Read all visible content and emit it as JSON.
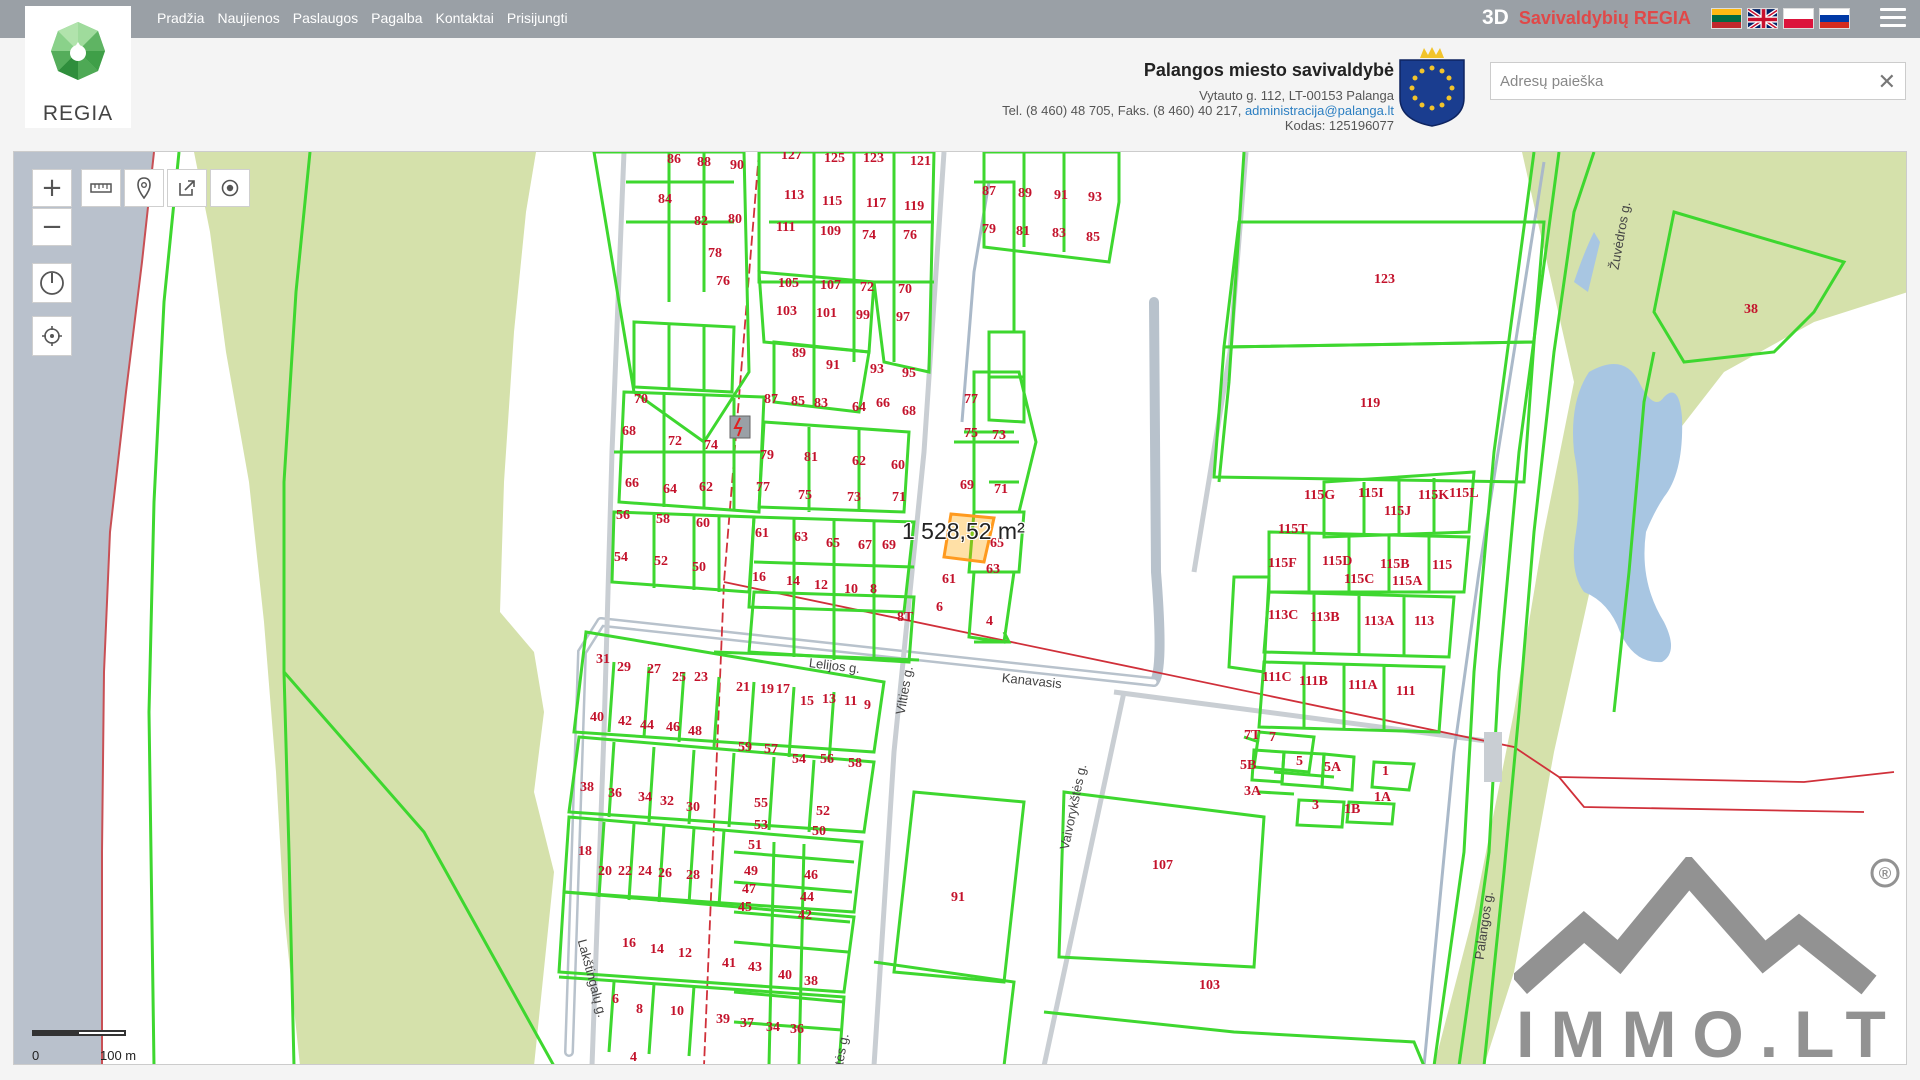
{
  "nav": {
    "items": [
      "Pradžia",
      "Naujienos",
      "Paslaugos",
      "Pagalba",
      "Kontaktai",
      "Prisijungti"
    ]
  },
  "logo": {
    "text": "REGIA"
  },
  "brand": {
    "prefix": "3D",
    "name": "Savivaldybių REGIA"
  },
  "languages": [
    "lithuania-flag",
    "uk-flag",
    "poland-flag",
    "russia-flag"
  ],
  "municipality": {
    "name": "Palangos miesto savivaldybė",
    "address": "Vytauto g. 112, LT-00153 Palanga",
    "phone_prefix": "Tel. (8 460) 48 705, Faks. (8 460) 40 217, ",
    "email": "administracija@palanga.lt",
    "code": "Kodas: 125196077"
  },
  "search": {
    "placeholder": "Adresų paieška",
    "value": ""
  },
  "map": {
    "measurement": "1 528,52 m²",
    "scale": {
      "zero": "0",
      "distance": "100 m"
    },
    "streets": {
      "lelijos": "Lelijos g.",
      "kanavasis": "Kanavasis",
      "vaivorykstes": "Vaivorykštės g.",
      "vilties": "Vilties g.",
      "vaivorykstes2": "Vaivorykštės g.",
      "lakstingalu": "Lakštingalų g.",
      "rudmiskiu": "Žuvėdros g.",
      "parkas": "Palangos g."
    },
    "plots": [
      {
        "id": "p1",
        "label": "86"
      },
      {
        "id": "p2",
        "label": "88"
      },
      {
        "id": "p3",
        "label": "90"
      },
      {
        "id": "p4",
        "label": "84"
      },
      {
        "id": "p5",
        "label": "82"
      },
      {
        "id": "p6",
        "label": "80"
      },
      {
        "id": "p7",
        "label": "78"
      },
      {
        "id": "p8",
        "label": "76"
      },
      {
        "id": "p9",
        "label": "127"
      },
      {
        "id": "p10",
        "label": "125"
      },
      {
        "id": "p11",
        "label": "123"
      },
      {
        "id": "p12",
        "label": "121"
      },
      {
        "id": "p13",
        "label": "113"
      },
      {
        "id": "p14",
        "label": "115"
      },
      {
        "id": "p15",
        "label": "117"
      },
      {
        "id": "p16",
        "label": "119"
      },
      {
        "id": "p17",
        "label": "111"
      },
      {
        "id": "p18",
        "label": "109"
      },
      {
        "id": "p19",
        "label": "74"
      },
      {
        "id": "p20",
        "label": "76"
      },
      {
        "id": "p21",
        "label": "105"
      },
      {
        "id": "p22",
        "label": "107"
      },
      {
        "id": "p23",
        "label": "72"
      },
      {
        "id": "p24",
        "label": "70"
      },
      {
        "id": "p25",
        "label": "103"
      },
      {
        "id": "p26",
        "label": "101"
      },
      {
        "id": "p27",
        "label": "99"
      },
      {
        "id": "p28",
        "label": "97"
      },
      {
        "id": "p29",
        "label": "89"
      },
      {
        "id": "p30",
        "label": "91"
      },
      {
        "id": "p31",
        "label": "93"
      },
      {
        "id": "p32",
        "label": "95"
      },
      {
        "id": "p33",
        "label": "87"
      },
      {
        "id": "p34",
        "label": "85"
      },
      {
        "id": "p35",
        "label": "83"
      },
      {
        "id": "p36",
        "label": "64"
      },
      {
        "id": "p37",
        "label": "66"
      },
      {
        "id": "p38",
        "label": "68"
      },
      {
        "id": "p39",
        "label": "87"
      },
      {
        "id": "p40",
        "label": "89"
      },
      {
        "id": "p41",
        "label": "91"
      },
      {
        "id": "p42",
        "label": "93"
      },
      {
        "id": "p43",
        "label": "79"
      },
      {
        "id": "p44",
        "label": "81"
      },
      {
        "id": "p45",
        "label": "83"
      },
      {
        "id": "p46",
        "label": "85"
      },
      {
        "id": "p47",
        "label": "70"
      },
      {
        "id": "p48",
        "label": "68"
      },
      {
        "id": "p49",
        "label": "72"
      },
      {
        "id": "p50",
        "label": "74"
      },
      {
        "id": "p51",
        "label": "66"
      },
      {
        "id": "p52",
        "label": "64"
      },
      {
        "id": "p53",
        "label": "62"
      },
      {
        "id": "p54",
        "label": "56"
      },
      {
        "id": "p55",
        "label": "58"
      },
      {
        "id": "p56",
        "label": "60"
      },
      {
        "id": "p57",
        "label": "54"
      },
      {
        "id": "p58",
        "label": "52"
      },
      {
        "id": "p59",
        "label": "50"
      },
      {
        "id": "p60",
        "label": "79"
      },
      {
        "id": "p61",
        "label": "81"
      },
      {
        "id": "p62",
        "label": "62"
      },
      {
        "id": "p63",
        "label": "60"
      },
      {
        "id": "p64",
        "label": "77"
      },
      {
        "id": "p65",
        "label": "75"
      },
      {
        "id": "p66",
        "label": "73"
      },
      {
        "id": "p67",
        "label": "71"
      },
      {
        "id": "p68",
        "label": "61"
      },
      {
        "id": "p69",
        "label": "63"
      },
      {
        "id": "p70",
        "label": "65"
      },
      {
        "id": "p71",
        "label": "67"
      },
      {
        "id": "p72",
        "label": "69"
      },
      {
        "id": "p73",
        "label": "16"
      },
      {
        "id": "p74",
        "label": "14"
      },
      {
        "id": "p75",
        "label": "12"
      },
      {
        "id": "p76",
        "label": "10"
      },
      {
        "id": "p77",
        "label": "8"
      },
      {
        "id": "p78",
        "label": "77"
      },
      {
        "id": "p79",
        "label": "75"
      },
      {
        "id": "p80",
        "label": "73"
      },
      {
        "id": "p81",
        "label": "69"
      },
      {
        "id": "p82",
        "label": "71"
      },
      {
        "id": "p83",
        "label": "63"
      },
      {
        "id": "p84",
        "label": "65"
      },
      {
        "id": "p85",
        "label": "61"
      },
      {
        "id": "p86",
        "label": "6"
      },
      {
        "id": "p87",
        "label": "4"
      },
      {
        "id": "p88",
        "label": "8T"
      },
      {
        "id": "p89",
        "label": "123"
      },
      {
        "id": "p90",
        "label": "119"
      },
      {
        "id": "p91",
        "label": "38"
      },
      {
        "id": "p92",
        "label": "115G"
      },
      {
        "id": "p93",
        "label": "115I"
      },
      {
        "id": "p94",
        "label": "115K"
      },
      {
        "id": "p95",
        "label": "115L"
      },
      {
        "id": "p96",
        "label": "115J"
      },
      {
        "id": "p97",
        "label": "115T"
      },
      {
        "id": "p98",
        "label": "115F"
      },
      {
        "id": "p99",
        "label": "115D"
      },
      {
        "id": "p100",
        "label": "115C"
      },
      {
        "id": "p101",
        "label": "115B"
      },
      {
        "id": "p102",
        "label": "115A"
      },
      {
        "id": "p103",
        "label": "115"
      },
      {
        "id": "p104",
        "label": "113C"
      },
      {
        "id": "p105",
        "label": "113B"
      },
      {
        "id": "p106",
        "label": "113A"
      },
      {
        "id": "p107",
        "label": "113"
      },
      {
        "id": "p108",
        "label": "111C"
      },
      {
        "id": "p109",
        "label": "111B"
      },
      {
        "id": "p110",
        "label": "111A"
      },
      {
        "id": "p111",
        "label": "111"
      },
      {
        "id": "p112",
        "label": "7T"
      },
      {
        "id": "p113",
        "label": "7"
      },
      {
        "id": "p114",
        "label": "5B"
      },
      {
        "id": "p115",
        "label": "5"
      },
      {
        "id": "p116",
        "label": "5A"
      },
      {
        "id": "p117",
        "label": "1"
      },
      {
        "id": "p118",
        "label": "3A"
      },
      {
        "id": "p119",
        "label": "3"
      },
      {
        "id": "p120",
        "label": "1B"
      },
      {
        "id": "p121",
        "label": "1A"
      },
      {
        "id": "p122",
        "label": "107"
      },
      {
        "id": "p123",
        "label": "103"
      },
      {
        "id": "p124",
        "label": "91"
      },
      {
        "id": "p125",
        "label": "31"
      },
      {
        "id": "p126",
        "label": "29"
      },
      {
        "id": "p127",
        "label": "27"
      },
      {
        "id": "p128",
        "label": "25"
      },
      {
        "id": "p129",
        "label": "23"
      },
      {
        "id": "p130",
        "label": "21"
      },
      {
        "id": "p131",
        "label": "19"
      },
      {
        "id": "p132",
        "label": "17"
      },
      {
        "id": "p133",
        "label": "15"
      },
      {
        "id": "p134",
        "label": "13"
      },
      {
        "id": "p135",
        "label": "11"
      },
      {
        "id": "p136",
        "label": "9"
      },
      {
        "id": "p137",
        "label": "40"
      },
      {
        "id": "p138",
        "label": "42"
      },
      {
        "id": "p139",
        "label": "44"
      },
      {
        "id": "p140",
        "label": "46"
      },
      {
        "id": "p141",
        "label": "48"
      },
      {
        "id": "p142",
        "label": "59"
      },
      {
        "id": "p143",
        "label": "57"
      },
      {
        "id": "p144",
        "label": "54"
      },
      {
        "id": "p145",
        "label": "56"
      },
      {
        "id": "p146",
        "label": "58"
      },
      {
        "id": "p147",
        "label": "38"
      },
      {
        "id": "p148",
        "label": "36"
      },
      {
        "id": "p149",
        "label": "34"
      },
      {
        "id": "p150",
        "label": "32"
      },
      {
        "id": "p151",
        "label": "30"
      },
      {
        "id": "p152",
        "label": "55"
      },
      {
        "id": "p153",
        "label": "52"
      },
      {
        "id": "p154",
        "label": "53"
      },
      {
        "id": "p155",
        "label": "50"
      },
      {
        "id": "p156",
        "label": "51"
      },
      {
        "id": "p157",
        "label": "18"
      },
      {
        "id": "p158",
        "label": "20"
      },
      {
        "id": "p159",
        "label": "22"
      },
      {
        "id": "p160",
        "label": "24"
      },
      {
        "id": "p161",
        "label": "26"
      },
      {
        "id": "p162",
        "label": "28"
      },
      {
        "id": "p163",
        "label": "49"
      },
      {
        "id": "p164",
        "label": "46"
      },
      {
        "id": "p165",
        "label": "47"
      },
      {
        "id": "p166",
        "label": "44"
      },
      {
        "id": "p167",
        "label": "45"
      },
      {
        "id": "p168",
        "label": "42"
      },
      {
        "id": "p169",
        "label": "16"
      },
      {
        "id": "p170",
        "label": "14"
      },
      {
        "id": "p171",
        "label": "12"
      },
      {
        "id": "p172",
        "label": "41"
      },
      {
        "id": "p173",
        "label": "43"
      },
      {
        "id": "p174",
        "label": "40"
      },
      {
        "id": "p175",
        "label": "38"
      },
      {
        "id": "p176",
        "label": "6"
      },
      {
        "id": "p177",
        "label": "8"
      },
      {
        "id": "p178",
        "label": "10"
      },
      {
        "id": "p179",
        "label": "39"
      },
      {
        "id": "p180",
        "label": "37"
      },
      {
        "id": "p181",
        "label": "34"
      },
      {
        "id": "p182",
        "label": "36"
      },
      {
        "id": "p183",
        "label": "4"
      }
    ]
  },
  "watermark": {
    "text": "IMMO.LT",
    "reg": "®"
  }
}
